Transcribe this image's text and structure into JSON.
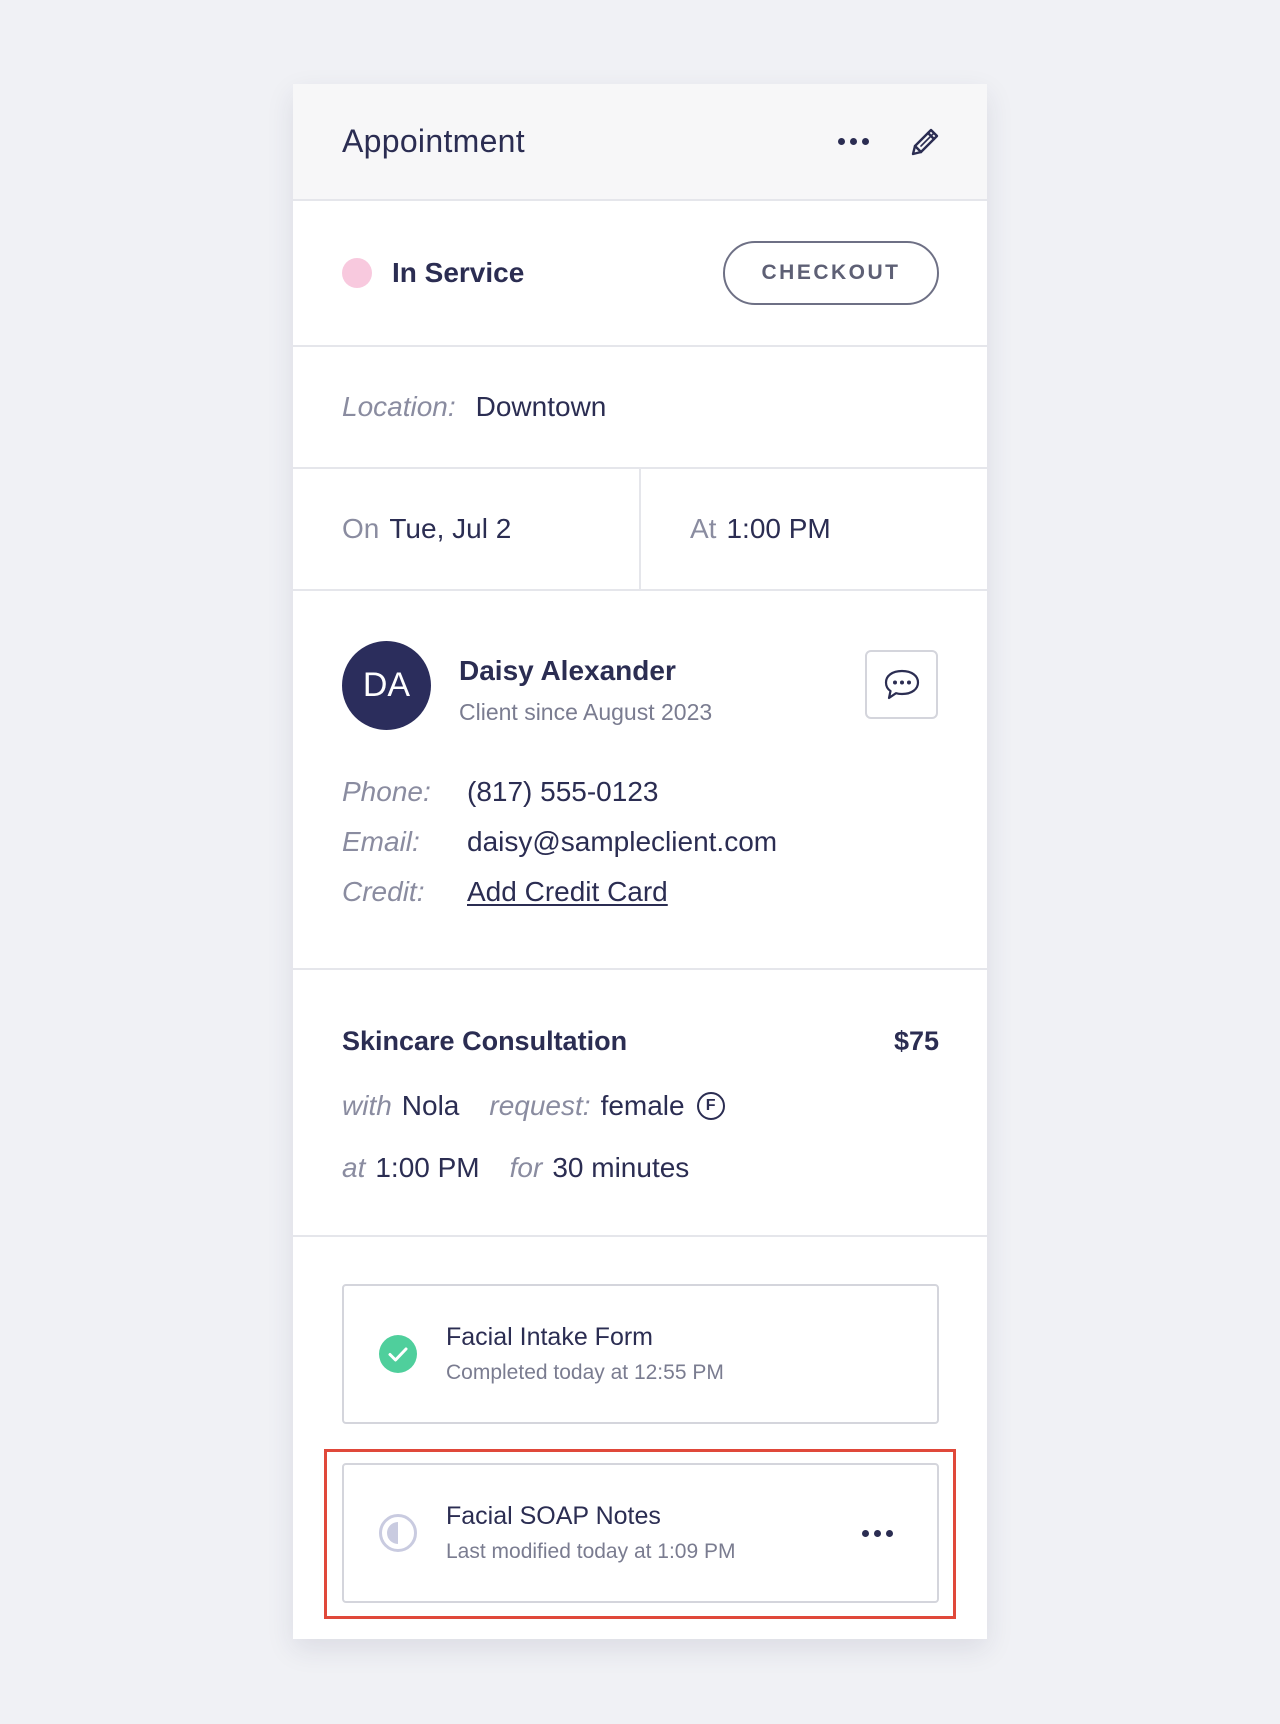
{
  "header": {
    "title": "Appointment"
  },
  "status": {
    "label": "In Service",
    "dot_color": "#f8c9de",
    "checkout_label": "CHECKOUT"
  },
  "location": {
    "label": "Location:",
    "value": "Downtown"
  },
  "datetime": {
    "on_label": "On",
    "date": "Tue, Jul 2",
    "at_label": "At",
    "time": "1:00 PM"
  },
  "client": {
    "initials": "DA",
    "name": "Daisy Alexander",
    "since": "Client since August 2023",
    "phone_label": "Phone:",
    "phone": "(817) 555-0123",
    "email_label": "Email:",
    "email": "daisy@sampleclient.com",
    "credit_label": "Credit:",
    "credit_link": "Add Credit Card"
  },
  "service": {
    "name": "Skincare Consultation",
    "price": "$75",
    "with_label": "with",
    "provider": "Nola",
    "request_label": "request:",
    "request_value": "female",
    "request_badge": "F",
    "at_label": "at",
    "time": "1:00 PM",
    "for_label": "for",
    "duration": "30 minutes"
  },
  "forms": [
    {
      "title": "Facial Intake Form",
      "subtitle": "Completed today at 12:55 PM",
      "status_icon": "check-circle-icon",
      "status_color": "#4fcf9c"
    },
    {
      "title": "Facial SOAP Notes",
      "subtitle": "Last modified today at 1:09 PM",
      "status_icon": "half-circle-icon",
      "status_color": "#c9cbe0"
    }
  ]
}
